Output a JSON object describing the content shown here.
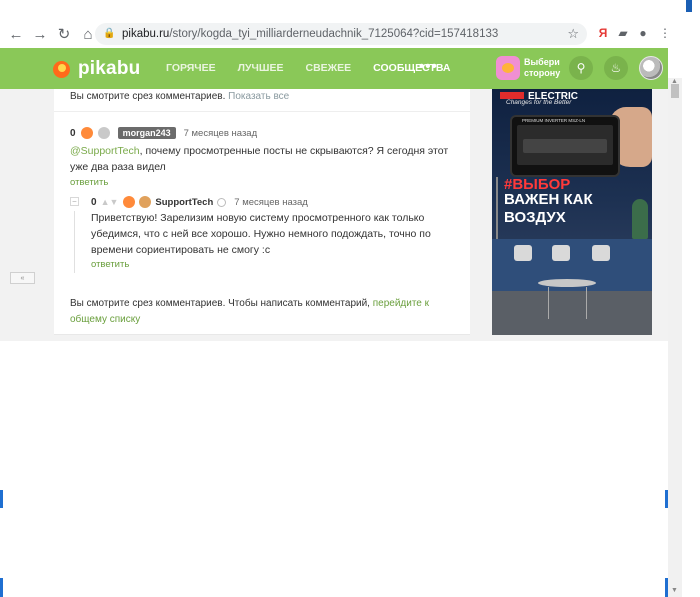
{
  "browser": {
    "url_host": "pikabu.ru",
    "url_path": "/story/kogda_tyi_milliarderneudachnik_7125064?cid=157418133",
    "back_icon": "arrow-left",
    "forward_icon": "arrow-right",
    "reload_icon": "reload",
    "home_icon": "home"
  },
  "header": {
    "logo_text": "pikabu",
    "nav": [
      "ГОРЯЧЕЕ",
      "ЛУЧШЕЕ",
      "СВЕЖЕЕ",
      "СООБЩЕСТВА"
    ],
    "more": "•••",
    "side_cta": "Выбери сторону",
    "brand_color": "#8ac858"
  },
  "comments": {
    "slice_top_text": "Вы смотрите срез комментариев.",
    "slice_top_link": "Показать все",
    "first": {
      "rating": "0",
      "author": "morgan243",
      "time": "7 месяцев назад",
      "mention": "@SupportTech",
      "text": ", почему просмотренные посты не скрываются? Я сегодня этот уже два раза видел",
      "reply": "ответить"
    },
    "second": {
      "rating": "0",
      "author": "SupportTech",
      "time": "7 месяцев назад",
      "text": "Приветствую! Зарелизим новую систему просмотренного как только убедимся, что с ней все хорошо. Нужно немного подождать, точно по времени сориентировать не смогу :с",
      "reply": "ответить"
    },
    "slice_bottom_text": "Вы смотрите срез комментариев. Чтобы написать комментарий,",
    "slice_bottom_link": "перейдите к общему списку"
  },
  "ad": {
    "brand": "ELECTRIC",
    "tagline": "Changes for the Better",
    "device_label": "PREMIUM INVERTER MSZ-LN",
    "headline_red": "#ВЫБОР",
    "headline": "ВАЖЕН КАК ВОЗДУХ"
  }
}
